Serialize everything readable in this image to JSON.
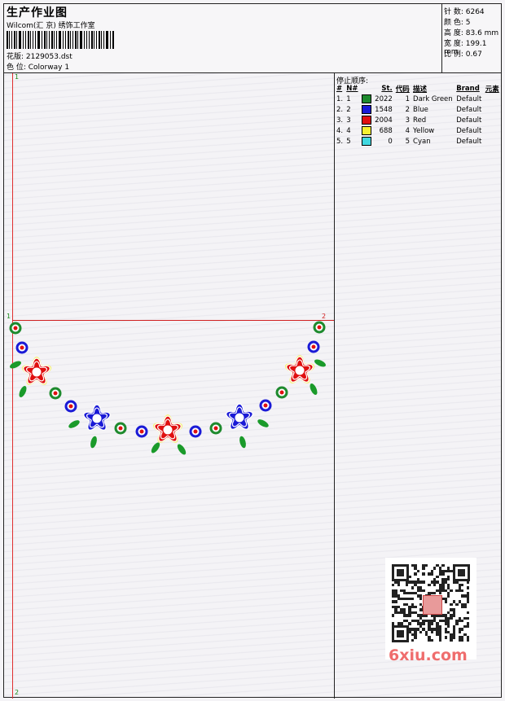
{
  "header": {
    "title": "生产作业图",
    "studio": "Wilcom(汇 京) 绣饰工作室",
    "design_label": "花版: 2129053.dst",
    "colorway_label": "色 位:  Colorway 1"
  },
  "stats": {
    "stitches": "针 数: 6264",
    "colors": "颜 色: 5",
    "height": "高 度: 83.6 mm",
    "width": "宽 度: 199.1 mm",
    "scale": "比 例: 0.67"
  },
  "canvas": {
    "pt_top": "1",
    "pt_left": "1",
    "pt_right": "2",
    "pt_bottom": "2"
  },
  "stop_sequence": {
    "title": "停止顺序:",
    "headers": [
      "#",
      "N#",
      "St.",
      "代码",
      "描述",
      "Brand",
      "元素"
    ],
    "rows": [
      {
        "idx": "1.",
        "n": "1",
        "color": "#1e8a2e",
        "st": "2022",
        "code": "1",
        "desc": "Dark Green",
        "brand": "Default"
      },
      {
        "idx": "2.",
        "n": "2",
        "color": "#1a1ad6",
        "st": "1548",
        "code": "2",
        "desc": "Blue",
        "brand": "Default"
      },
      {
        "idx": "3.",
        "n": "3",
        "color": "#e01010",
        "st": "2004",
        "code": "3",
        "desc": "Red",
        "brand": "Default"
      },
      {
        "idx": "4.",
        "n": "4",
        "color": "#f5f032",
        "st": "688",
        "code": "4",
        "desc": "Yellow",
        "brand": "Default"
      },
      {
        "idx": "5.",
        "n": "5",
        "color": "#40d8e0",
        "st": "0",
        "code": "5",
        "desc": "Cyan",
        "brand": "Default"
      }
    ]
  },
  "watermark": {
    "text": "6xiu.com"
  }
}
